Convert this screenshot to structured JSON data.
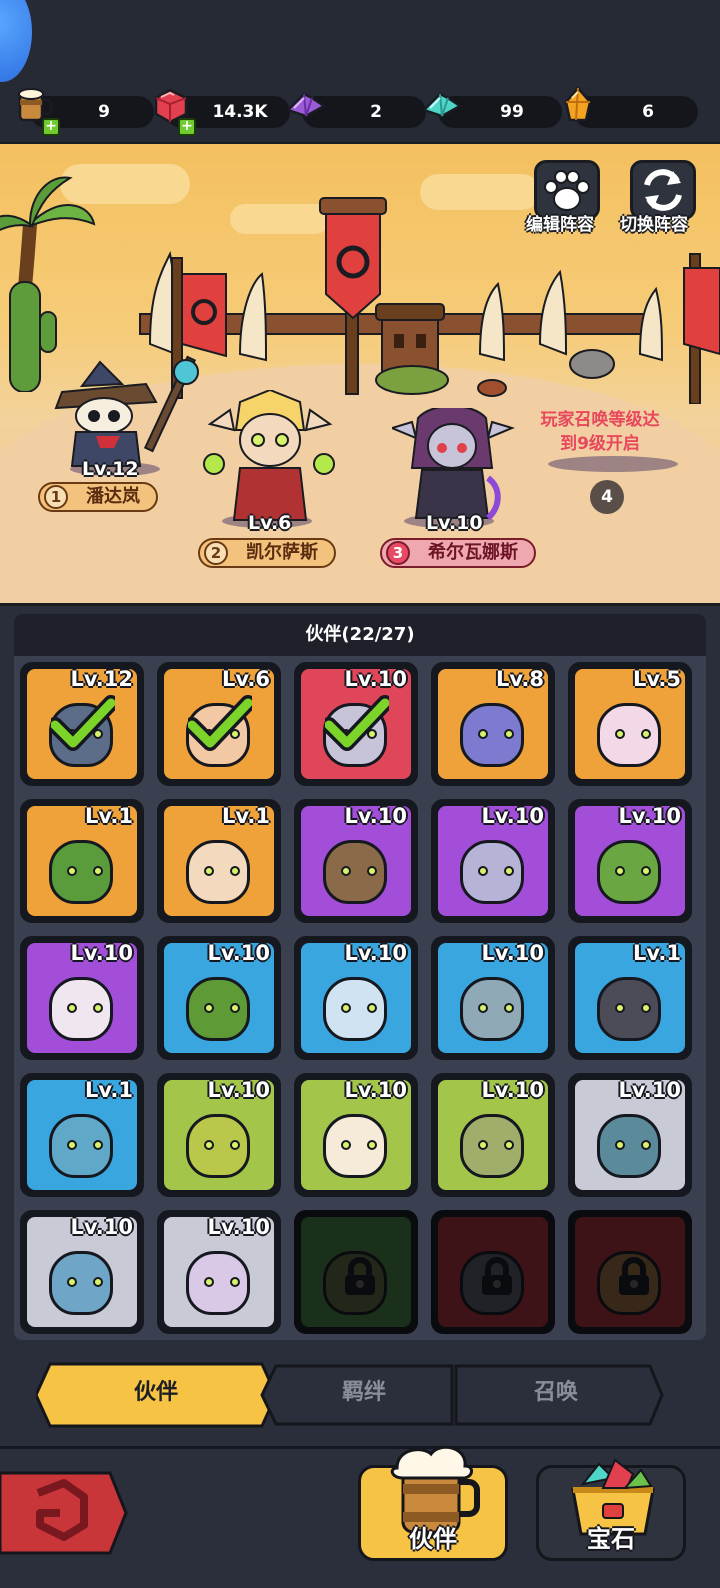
{
  "resources": [
    {
      "icon": "beer-mug-icon",
      "value": "9",
      "has_plus": true
    },
    {
      "icon": "ruby-icon",
      "value": "14.3K",
      "has_plus": true
    },
    {
      "icon": "purple-crystal-icon",
      "value": "2",
      "has_plus": false
    },
    {
      "icon": "teal-crystal-icon",
      "value": "99",
      "has_plus": false
    },
    {
      "icon": "amber-gem-icon",
      "value": "6",
      "has_plus": false
    }
  ],
  "scene": {
    "edit_formation_label": "编辑阵容",
    "switch_formation_label": "切换阵容",
    "heroes": [
      {
        "slot": "1",
        "level": "Lv.12",
        "name": "潘达岚",
        "style": "gold"
      },
      {
        "slot": "2",
        "level": "Lv.6",
        "name": "凯尔萨斯",
        "style": "gold"
      },
      {
        "slot": "3",
        "level": "Lv.10",
        "name": "希尔瓦娜斯",
        "style": "red"
      }
    ],
    "locked_slot": {
      "number": "4",
      "line1": "玩家召唤等级达",
      "line2": "到9级开启"
    }
  },
  "panel": {
    "title": "伙伴(22/27)",
    "cards": [
      {
        "level": "Lv.12",
        "bg": "#f0a23a",
        "skin": "#5c6d8a",
        "selected": true,
        "locked": false
      },
      {
        "level": "Lv.6",
        "bg": "#f0a23a",
        "skin": "#f2c9a4",
        "selected": true,
        "locked": false
      },
      {
        "level": "Lv.10",
        "bg": "#e0465a",
        "skin": "#c7c3d8",
        "selected": true,
        "locked": false
      },
      {
        "level": "Lv.8",
        "bg": "#f0a23a",
        "skin": "#7d7bd0",
        "selected": false,
        "locked": false
      },
      {
        "level": "Lv.5",
        "bg": "#f0a23a",
        "skin": "#f3d8e8",
        "selected": false,
        "locked": false
      },
      {
        "level": "Lv.1",
        "bg": "#f0a23a",
        "skin": "#5a9b3c",
        "selected": false,
        "locked": false
      },
      {
        "level": "Lv.1",
        "bg": "#f0a23a",
        "skin": "#f3d9bd",
        "selected": false,
        "locked": false
      },
      {
        "level": "Lv.10",
        "bg": "#a24ed8",
        "skin": "#8b6a4a",
        "selected": false,
        "locked": false
      },
      {
        "level": "Lv.10",
        "bg": "#a24ed8",
        "skin": "#b6b4d6",
        "selected": false,
        "locked": false
      },
      {
        "level": "Lv.10",
        "bg": "#a24ed8",
        "skin": "#6aa743",
        "selected": false,
        "locked": false
      },
      {
        "level": "Lv.10",
        "bg": "#a24ed8",
        "skin": "#efe6f0",
        "selected": false,
        "locked": false
      },
      {
        "level": "Lv.10",
        "bg": "#3aa6e0",
        "skin": "#5e9a35",
        "selected": false,
        "locked": false
      },
      {
        "level": "Lv.10",
        "bg": "#3aa6e0",
        "skin": "#cfe3f2",
        "selected": false,
        "locked": false
      },
      {
        "level": "Lv.10",
        "bg": "#3aa6e0",
        "skin": "#90a9b6",
        "selected": false,
        "locked": false
      },
      {
        "level": "Lv.1",
        "bg": "#3aa6e0",
        "skin": "#4b4c58",
        "selected": false,
        "locked": false
      },
      {
        "level": "Lv.1",
        "bg": "#3aa6e0",
        "skin": "#5fa8c8",
        "selected": false,
        "locked": false
      },
      {
        "level": "Lv.10",
        "bg": "#a3c64a",
        "skin": "#b9c84a",
        "selected": false,
        "locked": false
      },
      {
        "level": "Lv.10",
        "bg": "#a3c64a",
        "skin": "#f6ebd9",
        "selected": false,
        "locked": false
      },
      {
        "level": "Lv.10",
        "bg": "#a3c64a",
        "skin": "#9fae6a",
        "selected": false,
        "locked": false
      },
      {
        "level": "Lv.10",
        "bg": "#c8cbd6",
        "skin": "#5b8a9b",
        "selected": false,
        "locked": false
      },
      {
        "level": "Lv.10",
        "bg": "#c8cbd6",
        "skin": "#6fa6c8",
        "selected": false,
        "locked": false
      },
      {
        "level": "Lv.10",
        "bg": "#c8cbd6",
        "skin": "#d9c8e6",
        "selected": false,
        "locked": false
      },
      {
        "level": "",
        "bg": "#3a6a3a",
        "skin": "#4a5a3a",
        "selected": false,
        "locked": true
      },
      {
        "level": "",
        "bg": "#8a2a34",
        "skin": "#4a4a5a",
        "selected": false,
        "locked": true
      },
      {
        "level": "",
        "bg": "#8a2a34",
        "skin": "#7a5a3a",
        "selected": false,
        "locked": true
      }
    ]
  },
  "tabs": [
    {
      "label": "伙伴",
      "active": true
    },
    {
      "label": "羁绊",
      "active": false
    },
    {
      "label": "召唤",
      "active": false
    }
  ],
  "bottom": {
    "partner_label": "伙伴",
    "gem_label": "宝石"
  },
  "colors": {
    "accent_gold": "#f6c344",
    "panel_bg": "#3b4050",
    "check_green": "#7cd42a"
  }
}
